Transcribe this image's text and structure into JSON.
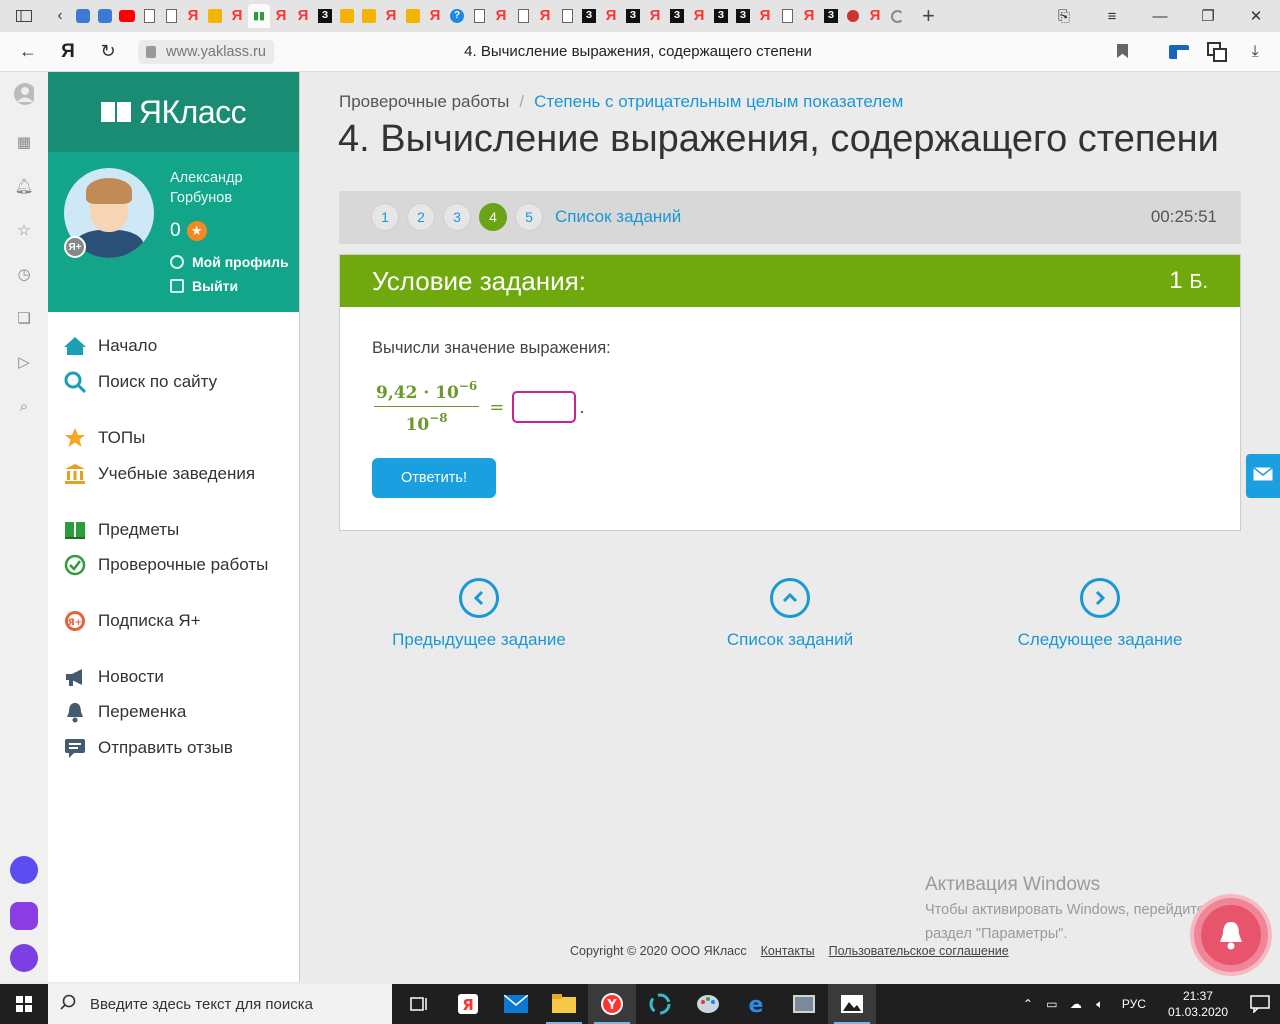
{
  "browser": {
    "address": "www.yaklass.ru",
    "page_title": "4. Вычисление выражения, содержащего степени"
  },
  "site": {
    "logo": "ЯКласс",
    "user": {
      "first": "Александр",
      "last": "Горбунов",
      "points": "0",
      "badge": "Я+"
    },
    "profile_link": "Мой профиль",
    "logout_link": "Выйти",
    "menu": [
      {
        "label": "Начало",
        "icon": "home-icon"
      },
      {
        "label": "Поиск по сайту",
        "icon": "search-icon"
      },
      {
        "label": "ТОПы",
        "icon": "star-icon"
      },
      {
        "label": "Учебные заведения",
        "icon": "institution-icon"
      },
      {
        "label": "Предметы",
        "icon": "book-icon"
      },
      {
        "label": "Проверочные работы",
        "icon": "check-circle-icon"
      },
      {
        "label": "Подписка Я+",
        "icon": "yaplus-icon"
      },
      {
        "label": "Новости",
        "icon": "megaphone-icon"
      },
      {
        "label": "Переменка",
        "icon": "bell-icon"
      },
      {
        "label": "Отправить отзыв",
        "icon": "feedback-icon"
      }
    ]
  },
  "main": {
    "breadcrumb_root": "Проверочные работы",
    "breadcrumb_sep": "/",
    "breadcrumb_link": "Степень с отрицательным целым показателем",
    "title": "4. Вычисление выражения, содержащего степени",
    "steps": [
      "1",
      "2",
      "3",
      "4",
      "5"
    ],
    "active_step": "4",
    "task_list_link": "Список заданий",
    "timer": "00:25:51",
    "task_header": "Условие задания:",
    "task_points": "1",
    "task_points_unit": "Б.",
    "question": "Вычисли значение выражения:",
    "formula": {
      "num_base": "9,42 · 10",
      "num_exp": "−6",
      "den_base": "10",
      "den_exp": "−8",
      "eq": "="
    },
    "answer_value": "",
    "answer_button": "Ответить!",
    "nav": {
      "prev": "Предыдущее задание",
      "list": "Список заданий",
      "next": "Следующее задание"
    }
  },
  "activation": {
    "title": "Активация Windows",
    "line1": "Чтобы активировать Windows, перейдите в",
    "line2": "раздел \"Параметры\"."
  },
  "footer": {
    "copyright": "Copyright © 2020 ООО ЯКласс",
    "contacts": "Контакты",
    "agreement": "Пользовательское соглашение"
  },
  "taskbar": {
    "search_placeholder": "Введите здесь текст для поиска",
    "lang": "РУС",
    "time": "21:37",
    "date": "01.03.2020"
  },
  "colors": {
    "brand": "#1a8c74",
    "task_header": "#6fa90d",
    "link": "#1a98d5",
    "button": "#1aa0e0"
  }
}
